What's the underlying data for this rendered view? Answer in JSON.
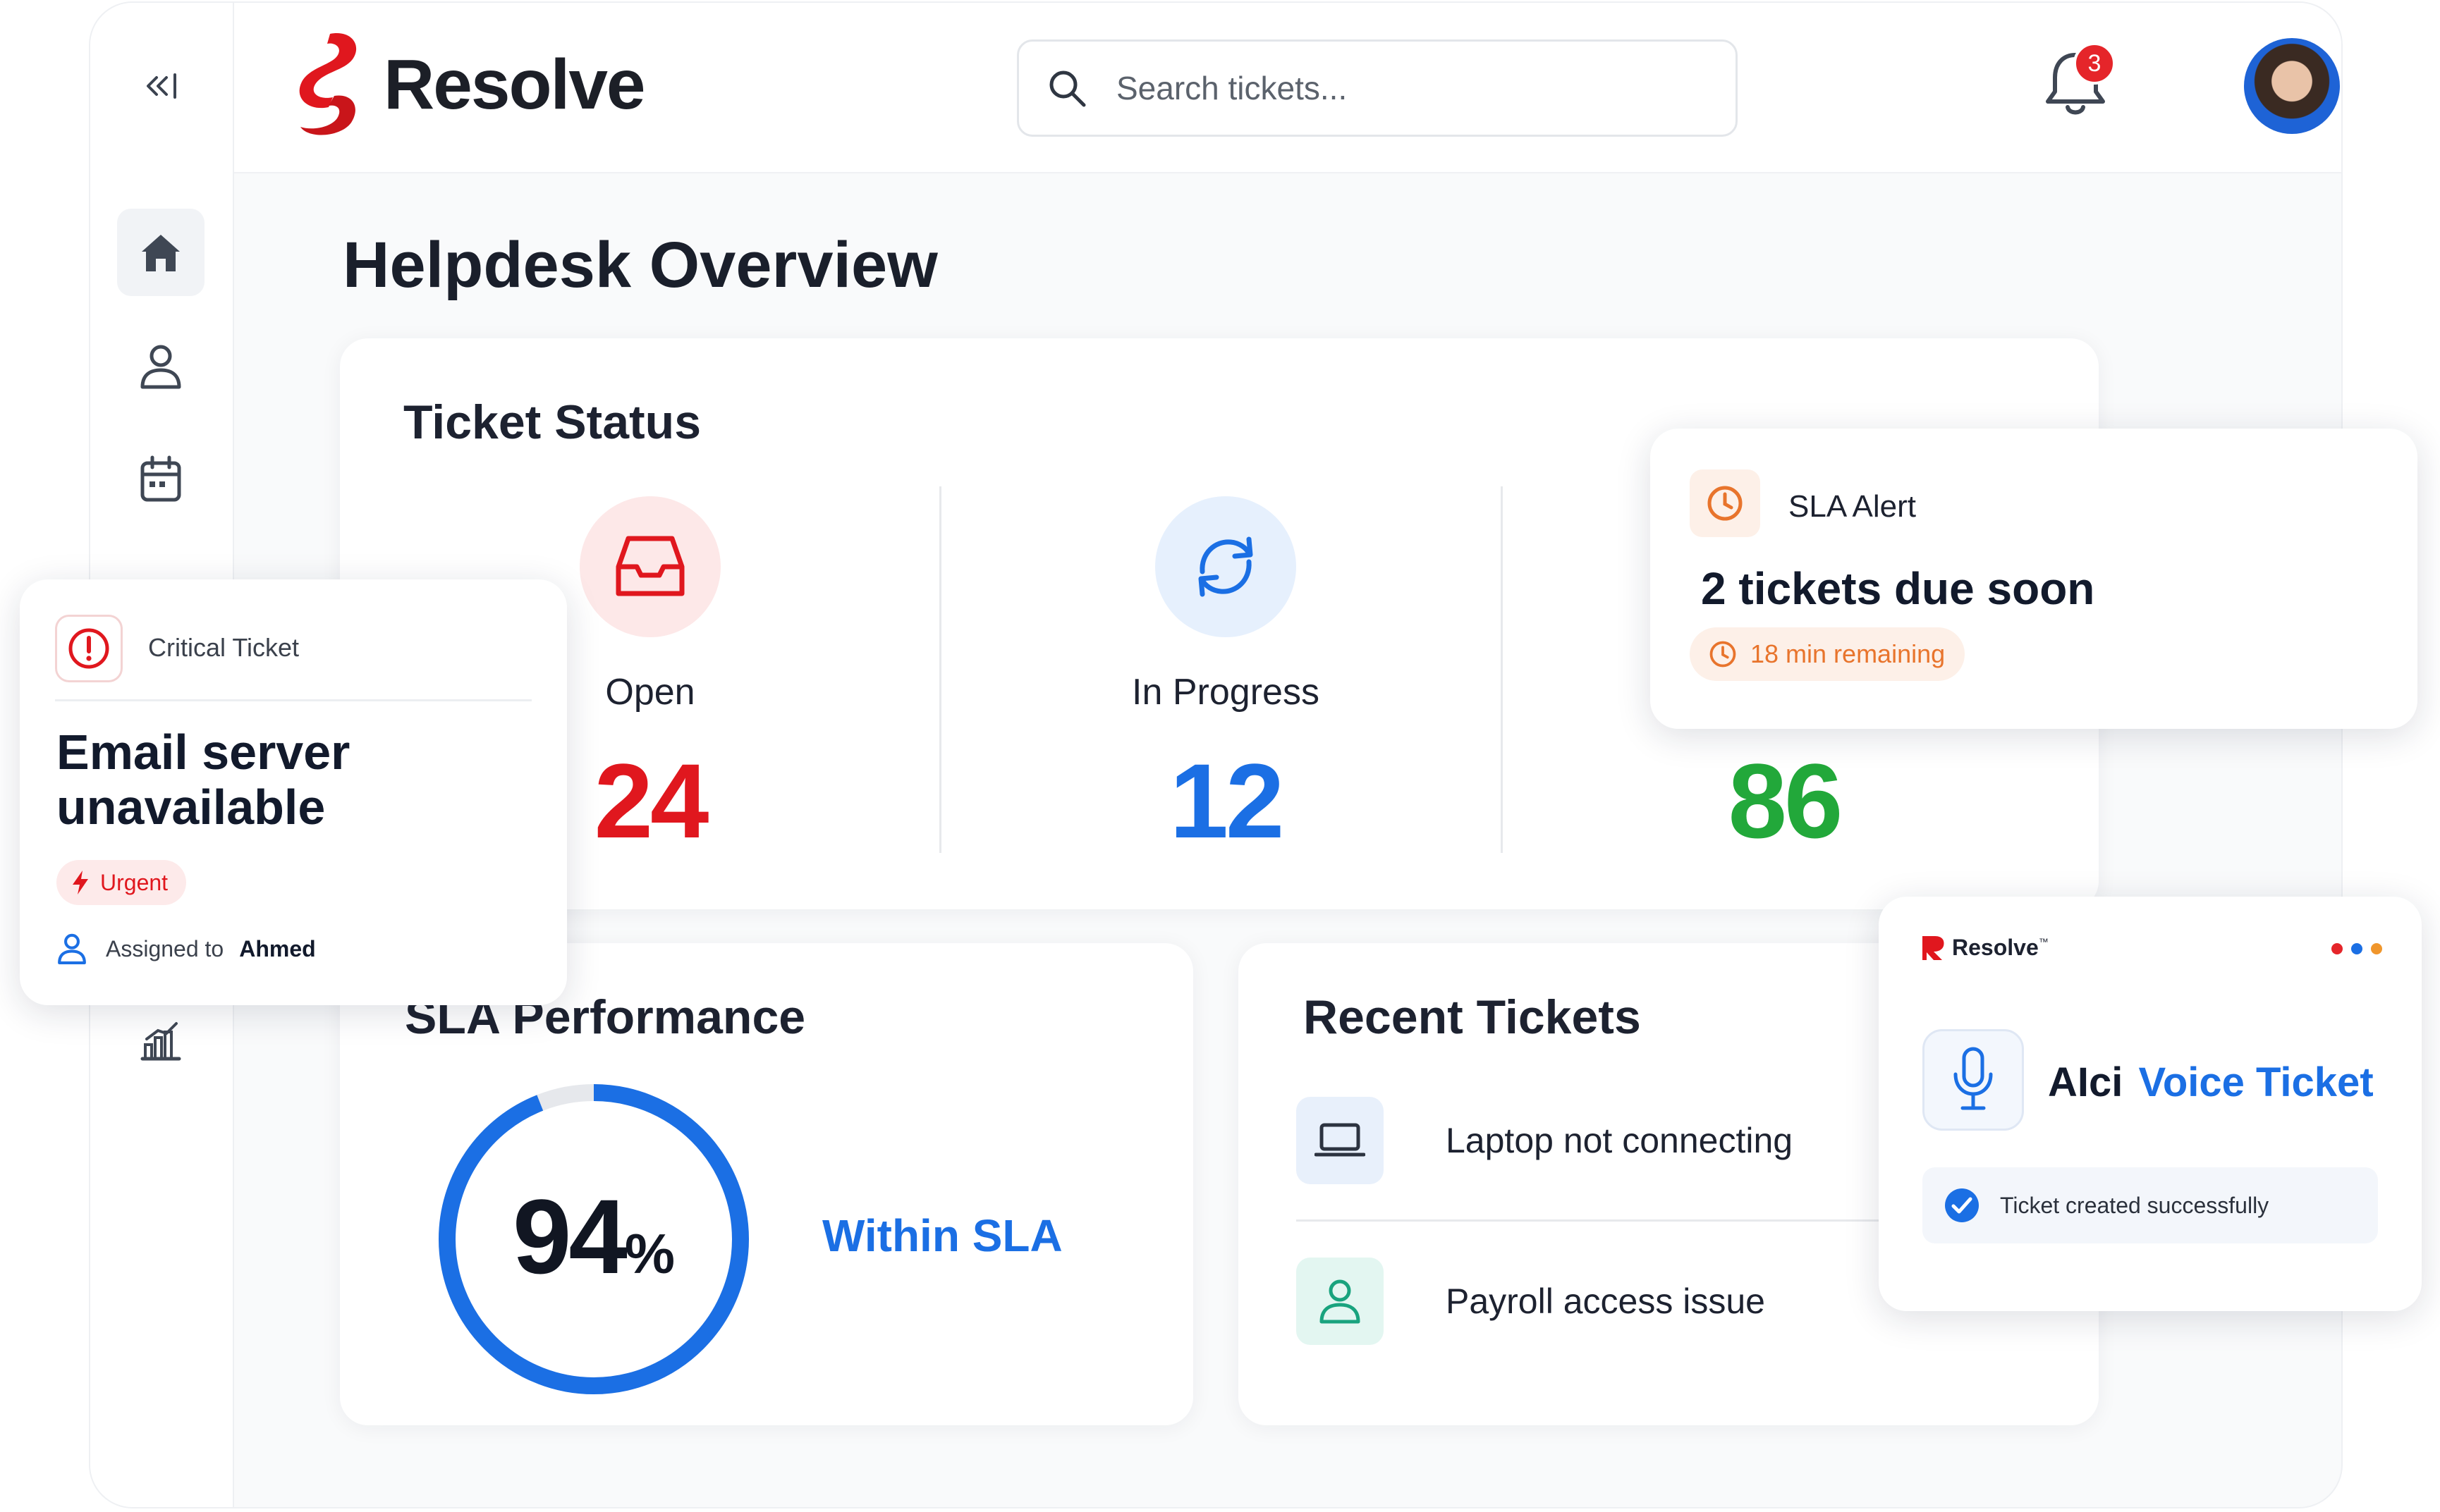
{
  "app": {
    "name": "Resolve"
  },
  "sidebar": {
    "collapse_label": "<<|",
    "items": [
      {
        "icon": "home-icon",
        "active": true
      },
      {
        "icon": "user-icon",
        "active": false
      },
      {
        "icon": "calendar-icon",
        "active": false
      },
      {
        "icon": "chart-icon",
        "active": false
      }
    ]
  },
  "search": {
    "placeholder": "Search tickets..."
  },
  "notifications": {
    "count": "3"
  },
  "page": {
    "title": "Helpdesk Overview"
  },
  "ticket_status": {
    "title": "Ticket Status",
    "items": [
      {
        "label": "Open",
        "value": "24",
        "color": "#e0171e"
      },
      {
        "label": "In Progress",
        "value": "12",
        "color": "#1b6fe4"
      },
      {
        "label": "",
        "value": "86",
        "color": "#22a83a"
      }
    ]
  },
  "sla_alert": {
    "title": "SLA Alert",
    "headline": "2 tickets due soon",
    "remaining": "18 min remaining"
  },
  "critical_ticket": {
    "title": "Critical Ticket",
    "headline": "Email server unavailable",
    "priority": "Urgent",
    "assigned_prefix": "Assigned to",
    "assignee": "Ahmed"
  },
  "sla_performance": {
    "title": "SLA Performance",
    "percent": "94",
    "percent_sign": "%",
    "label": "Within SLA",
    "fraction": 0.94
  },
  "recent_tickets": {
    "title": "Recent Tickets",
    "items": [
      {
        "label": "Laptop not connecting",
        "icon": "laptop-icon"
      },
      {
        "label": "Payroll access issue",
        "icon": "user-icon"
      }
    ]
  },
  "voice_ticket": {
    "brand": "Resolve",
    "brand_tm": "™",
    "title_prefix": "AIci",
    "title_highlight": "Voice Ticket",
    "status": "Ticket created successfully"
  },
  "colors": {
    "brand_red": "#e0171e",
    "accent_blue": "#1b6fe4",
    "success_green": "#22a83a",
    "warning_orange": "#e8742c"
  }
}
